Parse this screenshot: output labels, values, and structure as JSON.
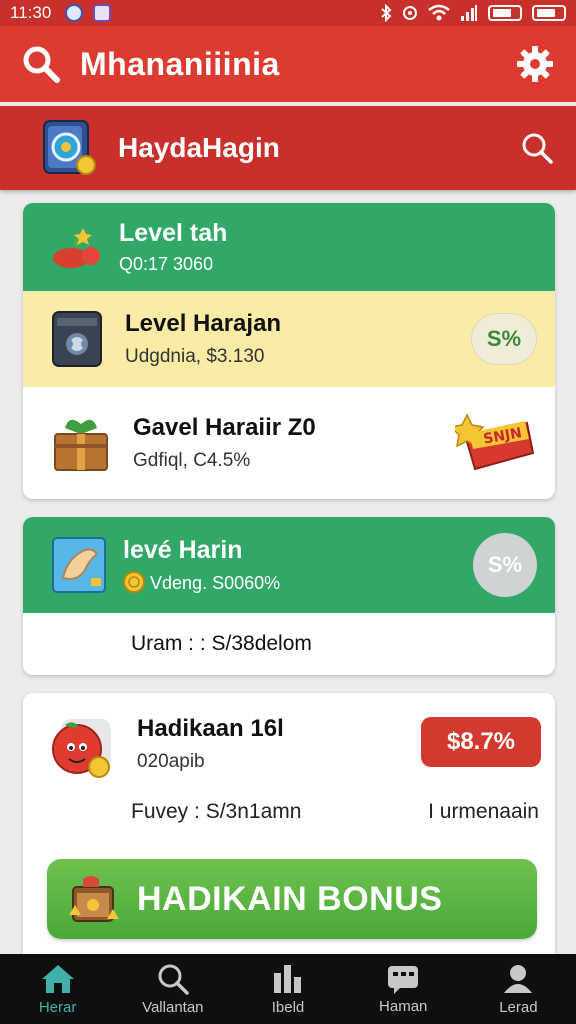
{
  "status_bar": {
    "time": "11:30"
  },
  "header": {
    "title": "Mhananiiinia"
  },
  "sub_header": {
    "title": "HaydaHagin"
  },
  "card1": {
    "header": {
      "title": "Level tah",
      "subtitle": "Q0:17 3060"
    },
    "rows": [
      {
        "title": "Level Harajan",
        "subtitle": "Udgdnia, $3.130",
        "badge": "S%"
      },
      {
        "title": "Gavel Haraiir    Z0",
        "subtitle": "Gdfiql, C4.5%",
        "badge": "SNJN"
      }
    ]
  },
  "card2": {
    "header": {
      "title": "levé Harin",
      "subtitle": "Vdeng. S0060%",
      "badge": "S%"
    },
    "footer": "Uram : : S/38delom"
  },
  "card3": {
    "title": "Hadikaan    16l",
    "subtitle": "020apib",
    "price": "$8.7%",
    "detail_left": "Fuvey : S/3n1amn",
    "detail_right": "I urmenaain",
    "bonus_label": "HADIKAIN BONUS"
  },
  "bottom_nav": [
    {
      "label": "Herar",
      "icon": "home-icon",
      "active": true
    },
    {
      "label": "Vallantan",
      "icon": "search-icon",
      "active": false
    },
    {
      "label": "Ibeld",
      "icon": "stats-icon",
      "active": false
    },
    {
      "label": "Haman",
      "icon": "chat-icon",
      "active": false
    },
    {
      "label": "Lerad",
      "icon": "profile-icon",
      "active": false
    }
  ],
  "colors": {
    "header_red": "#db3b30",
    "green": "#31a868",
    "yellow_row": "#faeca6",
    "price_red": "#d33a2f",
    "nav_active": "#3fb1a8"
  }
}
